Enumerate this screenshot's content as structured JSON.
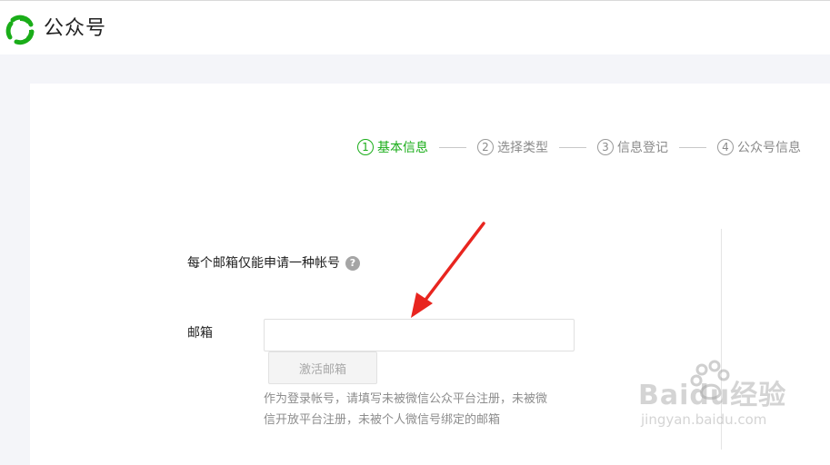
{
  "header": {
    "brand_text": "公众号",
    "logo_color": "#1aad19"
  },
  "steps": [
    {
      "num": "1",
      "label": "基本信息",
      "active": true
    },
    {
      "num": "2",
      "label": "选择类型",
      "active": false
    },
    {
      "num": "3",
      "label": "信息登记",
      "active": false
    },
    {
      "num": "4",
      "label": "公众号信息",
      "active": false
    }
  ],
  "form": {
    "notice": "每个邮箱仅能申请一种帐号",
    "help_icon": "question-circle-icon",
    "email_label": "邮箱",
    "email_value": "",
    "email_placeholder": "",
    "activate_button": "激活邮箱",
    "hint": "作为登录帐号，请填写未被微信公众平台注册，未被微信开放平台注册，未被个人微信号绑定的邮箱"
  },
  "annotation": {
    "arrow_color": "#e8251f"
  },
  "watermark": {
    "main": "Baidu经验",
    "sub": "jingyan.baidu.com"
  },
  "colors": {
    "accent": "#1aad19",
    "page_bg": "#f4f5f9"
  }
}
